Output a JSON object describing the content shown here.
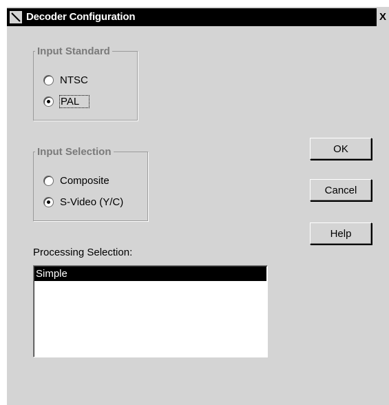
{
  "window": {
    "title": "Decoder Configuration",
    "close_label": "X"
  },
  "input_standard": {
    "legend": "Input Standard",
    "options": [
      {
        "label": "NTSC",
        "checked": false
      },
      {
        "label": "PAL",
        "checked": true
      }
    ]
  },
  "input_selection": {
    "legend": "Input Selection",
    "options": [
      {
        "label": "Composite",
        "checked": false
      },
      {
        "label": "S-Video (Y/C)",
        "checked": true
      }
    ]
  },
  "buttons": {
    "ok": "OK",
    "cancel": "Cancel",
    "help": "Help"
  },
  "processing": {
    "label": "Processing Selection:",
    "items": [
      {
        "label": "Simple",
        "selected": true
      }
    ]
  }
}
